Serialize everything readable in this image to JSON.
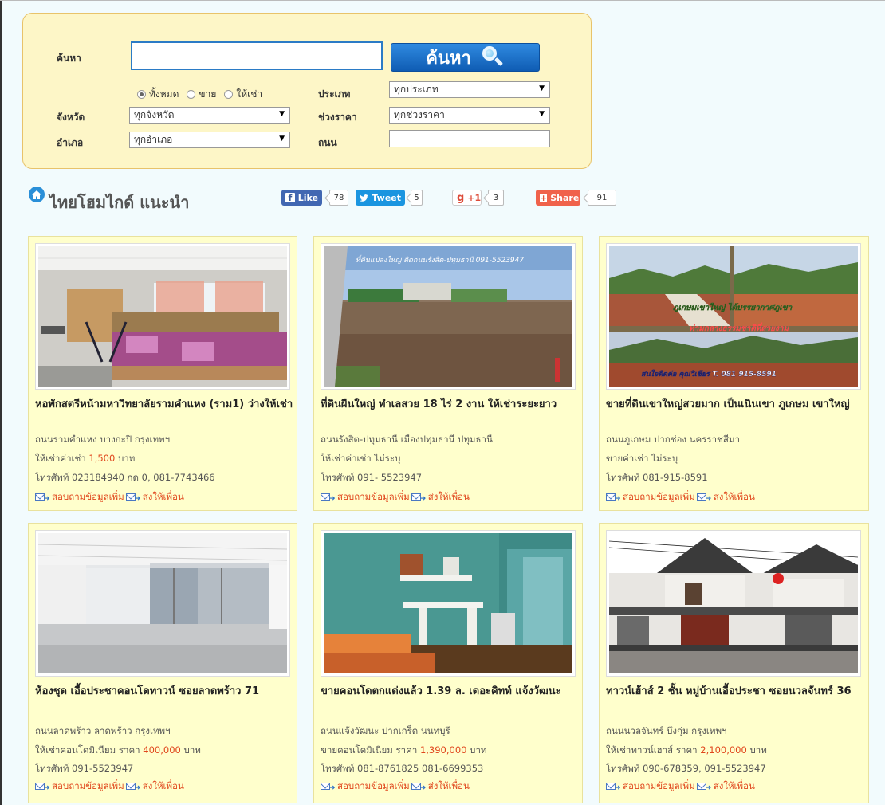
{
  "search": {
    "label_search": "ค้นหา",
    "query_value": "",
    "button_label": "ค้นหา",
    "radio_all": "ทั้งหมด",
    "radio_sale": "ขาย",
    "radio_rent": "ให้เช่า",
    "label_type": "ประเภท",
    "type_selected": "ทุกประเภท",
    "label_province": "จังหวัด",
    "province_selected": "ทุกจังหวัด",
    "label_price": "ช่วงราคา",
    "price_selected": "ทุกช่วงราคา",
    "label_district": "อำเภอ",
    "district_selected": "ทุกอำเภอ",
    "label_road": "ถนน",
    "road_value": ""
  },
  "section": {
    "title": "ไทยโฮมไกด์ แนะนำ"
  },
  "share": {
    "fb_label": "Like",
    "fb_count": "78",
    "tw_label": "Tweet",
    "tw_count": "5",
    "gplus_label": "+1",
    "gplus_count": "3",
    "share_label": "Share",
    "share_count": "91"
  },
  "listings": [
    {
      "title": "หอพักสตรีหน้ามหาวิทยาลัยรามคำแหง (ราม1) ว่างให้เช่า",
      "location": "ถนนรามคำแหง บางกะปิ กรุงเทพฯ",
      "price_prefix": "ให้เช่าค่าเช่า ",
      "price": "1,500",
      "price_suffix": " บาท",
      "phone": "โทรศัพท์ 023184940 กด 0, 081-7743466",
      "inquire": "สอบถามข้อมูลเพิ่ม",
      "send": "ส่งให้เพื่อน"
    },
    {
      "title": "ที่ดินผืนใหญ่ ทำเลสวย 18 ไร่ 2 งาน ให้เช่าระยะยาว",
      "location": "ถนนรังสิต-ปทุมธานี เมืองปทุมธานี ปทุมธานี",
      "price_prefix": "ให้เช่าค่าเช่า ไม่ระบุ",
      "price": "",
      "price_suffix": "",
      "phone": "โทรศัพท์ 091- 5523947",
      "inquire": "สอบถามข้อมูลเพิ่ม",
      "send": "ส่งให้เพื่อน",
      "photo_caption": "ที่ดินแปลงใหญ่ ติดถนนรังสิต-ปทุมธานี 091-5523947"
    },
    {
      "title": "ขายที่ดินเขาใหญ่สวยมาก เป็นเนินเขา ภูเกษม เขาใหญ่",
      "location": "ถนนภูเกษม ปากช่อง นครราชสีมา",
      "price_prefix": "ขายค่าเช่า ไม่ระบุ",
      "price": "",
      "price_suffix": "",
      "phone": "โทรศัพท์ 081-915-8591",
      "inquire": "สอบถามข้อมูลเพิ่ม",
      "send": "ส่งให้เพื่อน",
      "photo_caption_1": "ภูเกษมเขาใหญ่ ได้บรรยากาศภูเขา",
      "photo_caption_2": "ท่ามกลางธรรมชาติที่สวยงาม",
      "photo_caption_3": "สนใจติดต่อ คุณวิเชียร T. 081 915-8591"
    },
    {
      "title": "ห้องชุด เอื้อประชาคอนโดทาวน์ ซอยลาดพร้าว 71",
      "location": "ถนนลาดพร้าว ลาดพร้าว กรุงเทพฯ",
      "price_prefix": "ให้เช่าคอนโดมิเนียม ราคา ",
      "price": "400,000",
      "price_suffix": " บาท",
      "phone": "โทรศัพท์ 091-5523947",
      "inquire": "สอบถามข้อมูลเพิ่ม",
      "send": "ส่งให้เพื่อน"
    },
    {
      "title": "ขายคอนโดตกแต่งแล้ว 1.39 ล. เดอะคิทท์ แจ้งวัฒนะ",
      "location": "ถนนแจ้งวัฒนะ ปากเกร็ด นนทบุรี",
      "price_prefix": "ขายคอนโดมิเนียม ราคา ",
      "price": "1,390,000",
      "price_suffix": " บาท",
      "phone": "โทรศัพท์ 081-8761825 081-6699353",
      "inquire": "สอบถามข้อมูลเพิ่ม",
      "send": "ส่งให้เพื่อน"
    },
    {
      "title": "ทาวน์เฮ้าส์ 2 ชั้น หมู่บ้านเอื้อประชา ซอยนวลจันทร์ 36",
      "location": "ถนนนวลจันทร์ บึงกุ่ม กรุงเทพฯ",
      "price_prefix": "ให้เช่าทาวน์เฮาส์ ราคา ",
      "price": "2,100,000",
      "price_suffix": " บาท",
      "phone": "โทรศัพท์ 090-678359, 091-5523947",
      "inquire": "สอบถามข้อมูลเพิ่ม",
      "send": "ส่งให้เพื่อน"
    }
  ]
}
